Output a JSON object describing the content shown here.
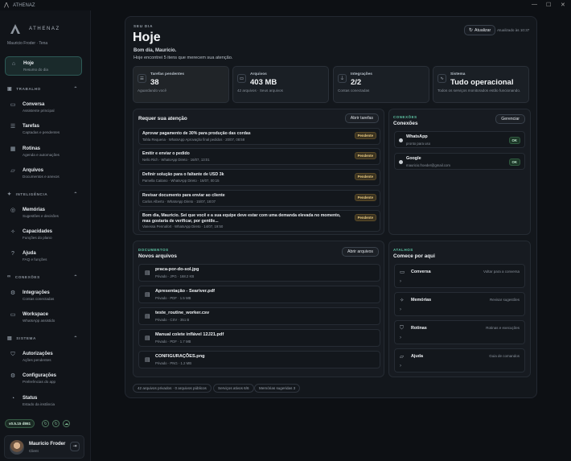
{
  "window": {
    "title": "ATHENAZ"
  },
  "brand": {
    "name": "ATHENAZ",
    "user_subtitle": "Mauricio Froder · Tena"
  },
  "nav": {
    "home": {
      "title": "Hoje",
      "sub": "Resumo do dia"
    },
    "sections": [
      {
        "label": "TRABALHO"
      },
      {
        "label": "INTELIGÊNCIA"
      },
      {
        "label": "CONEXÕES"
      },
      {
        "label": "SISTEMA"
      }
    ],
    "items": [
      {
        "title": "Conversa",
        "sub": "Assistente principal",
        "icon": "chat-icon"
      },
      {
        "title": "Tarefas",
        "sub": "Captadas e pendentes",
        "icon": "tasks-icon"
      },
      {
        "title": "Rotinas",
        "sub": "Agenda e automações",
        "icon": "calendar-icon"
      },
      {
        "title": "Arquivos",
        "sub": "Documentos e anexos",
        "icon": "folder-icon"
      },
      {
        "title": "Memórias",
        "sub": "Sugestões e decisões",
        "icon": "memory-icon"
      },
      {
        "title": "Capacidades",
        "sub": "Funções do plano",
        "icon": "puzzle-icon"
      },
      {
        "title": "Ajuda",
        "sub": "FAQ e funções",
        "icon": "help-icon"
      },
      {
        "title": "Integrações",
        "sub": "Contas conectadas",
        "icon": "integration-icon"
      },
      {
        "title": "Workspace",
        "sub": "WhatsApp assistido",
        "icon": "workspace-icon"
      },
      {
        "title": "Autorizações",
        "sub": "Ações pendentes",
        "icon": "shield-icon"
      },
      {
        "title": "Configurações",
        "sub": "Preferências do app",
        "icon": "settings-icon"
      },
      {
        "title": "Status",
        "sub": "Estado da instância",
        "icon": "status-icon"
      }
    ]
  },
  "version": "v0.5.15 d861",
  "user": {
    "name": "Mauricio Froder",
    "role": "Client"
  },
  "header": {
    "eyebrow": "SEU DIA",
    "title": "Hoje",
    "greeting": "Bom dia, Mauricio.",
    "subtitle": "Hoje encontrei 5 itens que merecem sua atenção.",
    "refresh_label": "Atualizar",
    "updated": "Atualizado às 10:37"
  },
  "stats": [
    {
      "label": "Tarefas pendentes",
      "value": "38",
      "sub": "Aguardando você"
    },
    {
      "label": "Arquivos",
      "value": "403 MB",
      "sub": "42 arquivos · Seus arquivos"
    },
    {
      "label": "Integrações",
      "value": "2/2",
      "sub": "Contas conectadas"
    },
    {
      "label": "Sistema",
      "value": "Tudo operacional",
      "sub": "Todos os serviços monitorados estão funcionando."
    }
  ],
  "attention": {
    "title": "Requer sua atenção",
    "button": "Abrir tarefas",
    "badge": "Pendente",
    "items": [
      {
        "title": "Aprovar pagamento de 30% para produção das cordas",
        "sub": "Tahla Requena · WhatsApp Aprovação final pedidos · 20/07, 08:58"
      },
      {
        "title": "Emitir e enviar o pedido",
        "sub": "Nello Rich · WhatsApp Direto · 16/07, 13:01"
      },
      {
        "title": "Definir solução para o faltante de USD 3k",
        "sub": "Pamella Caitano · WhatsApp Direto · 16/07, 00:15"
      },
      {
        "title": "Revisar documento para enviar ao cliente",
        "sub": "Carlos Alberto · WhatsApp Direto · 15/07, 18:07"
      },
      {
        "title": "Bom dia, Mauricio. Sei que você e a sua equipe deve estar com uma demanda elevada no momento, mas gostaria de verificar, por gentile...",
        "sub": "Vanessa Pennafort · WhatsApp Direto · 14/07, 19:50"
      }
    ]
  },
  "connections": {
    "eyebrow": "CONEXÕES",
    "title": "Conexões",
    "button": "Gerenciar",
    "badge": "OK",
    "items": [
      {
        "name": "WhatsApp",
        "sub": "pronto para uso"
      },
      {
        "name": "Google",
        "sub": "mauricio.froeder@gmail.com"
      }
    ]
  },
  "documents": {
    "eyebrow": "DOCUMENTOS",
    "title": "Novos arquivos",
    "button": "Abrir arquivos",
    "items": [
      {
        "name": "praca-por-do-sol.jpg",
        "meta": "Privado · JPG · 168.2 KB"
      },
      {
        "name": "Apresentação - Seariver.pdf",
        "meta": "Privado · PDF · 1.5 MB"
      },
      {
        "name": "teste_routine_worker.csv",
        "meta": "Privado · CSV · 351 B"
      },
      {
        "name": "Manual colete inflável 12J21.pdf",
        "meta": "Privado · PDF · 1.7 MB"
      },
      {
        "name": "CONFIGURAÇÕES.png",
        "meta": "Privado · PNG · 1.2 MB"
      }
    ]
  },
  "shortcuts": {
    "eyebrow": "ATALHOS",
    "title": "Comece por aqui",
    "arrow": "›",
    "items": [
      {
        "title": "Conversa",
        "desc": "Voltar para a conversa",
        "icon": "chat-icon"
      },
      {
        "title": "Memórias",
        "desc": "Revisar sugestões",
        "icon": "memory-icon"
      },
      {
        "title": "Rotinas",
        "desc": "Rotinas e execuções",
        "icon": "routine-icon"
      },
      {
        "title": "Ajuda",
        "desc": "Guia de comandos",
        "icon": "help-icon"
      }
    ]
  },
  "footer": {
    "pills": [
      "42 arquivos privados · 0 arquivos públicos",
      "Serviços ativos 6/6",
      "Memórias sugeridas 3"
    ]
  },
  "colors": {
    "accent": "#5fc7a6",
    "pending": "#e7c980",
    "ok": "#bfe8cf",
    "background": "#0d1014"
  }
}
